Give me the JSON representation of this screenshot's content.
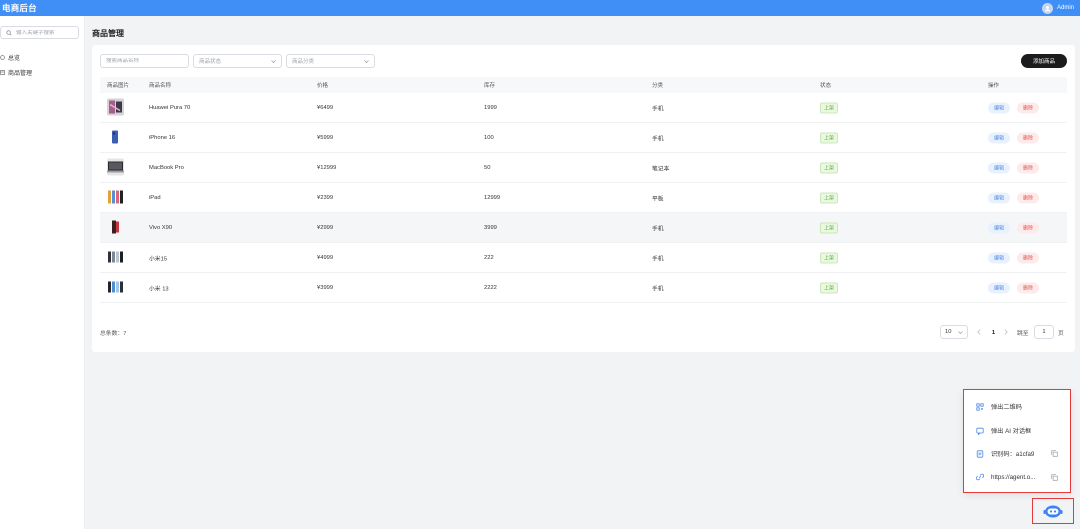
{
  "header": {
    "brand": "电商后台",
    "user": "Admin"
  },
  "sidebar": {
    "search_placeholder": "输入关键字搜索",
    "items": [
      {
        "label": "总览"
      },
      {
        "label": "商品管理"
      }
    ]
  },
  "page": {
    "title": "商品管理"
  },
  "filters": {
    "name_placeholder": "搜索商品名称",
    "status_placeholder": "商品状态",
    "category_placeholder": "商品分类",
    "add_label": "添加商品"
  },
  "table": {
    "headers": [
      "商品图片",
      "商品名称",
      "价格",
      "库存",
      "分类",
      "状态",
      "操作"
    ],
    "edit_label": "编辑",
    "delete_label": "删除",
    "rows": [
      {
        "name": "Huawei Pura 70",
        "price": "¥6499",
        "stock": "1999",
        "category": "手机",
        "status": "上架"
      },
      {
        "name": "iPhone 16",
        "price": "¥5999",
        "stock": "100",
        "category": "手机",
        "status": "上架"
      },
      {
        "name": "MacBook Pro",
        "price": "¥12999",
        "stock": "50",
        "category": "笔记本",
        "status": "上架"
      },
      {
        "name": "iPad",
        "price": "¥2399",
        "stock": "12999",
        "category": "平板",
        "status": "上架"
      },
      {
        "name": "Vivo X90",
        "price": "¥2999",
        "stock": "3999",
        "category": "手机",
        "status": "上架"
      },
      {
        "name": "小米15",
        "price": "¥4999",
        "stock": "222",
        "category": "手机",
        "status": "上架"
      },
      {
        "name": "小米 13",
        "price": "¥3999",
        "stock": "2222",
        "category": "手机",
        "status": "上架"
      }
    ]
  },
  "pagination": {
    "total_label": "总条数：",
    "total": "7",
    "page_size": "10",
    "current_page": "1",
    "jump_label": "跳至",
    "jump_value": "1",
    "page_unit": "页"
  },
  "popup": {
    "items": [
      {
        "label": "弹出二维码",
        "icon": "qr-code-icon"
      },
      {
        "label": "弹出 AI 对话框",
        "icon": "chat-icon"
      },
      {
        "label": "识别码：a1cfa9",
        "icon": "id-card-icon"
      },
      {
        "label": "https://agent.o...",
        "icon": "link-icon"
      }
    ]
  },
  "colors": {
    "header": "#3f8ff7",
    "accent_red": "#e53a3a",
    "status_green": "#59b33c"
  }
}
